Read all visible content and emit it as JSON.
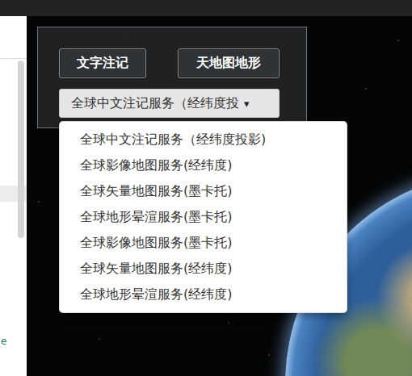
{
  "sidebar": {
    "fragment": "e"
  },
  "toolbar": {
    "buttons": [
      {
        "label": "文字注记"
      },
      {
        "label": "天地图地形"
      }
    ]
  },
  "dropdown": {
    "value": "全球中文注记服务（经纬度投",
    "caret": "▾",
    "expanded": true,
    "options": [
      {
        "label": "全球中文注记服务（经纬度投影)"
      },
      {
        "label": "全球影像地图服务(经纬度)"
      },
      {
        "label": "全球矢量地图服务(墨卡托)"
      },
      {
        "label": "全球地形晕渲服务(墨卡托)"
      },
      {
        "label": "全球影像地图服务(墨卡托)"
      },
      {
        "label": "全球矢量地图服务(经纬度)"
      },
      {
        "label": "全球地形晕渲服务(经纬度)"
      }
    ]
  }
}
